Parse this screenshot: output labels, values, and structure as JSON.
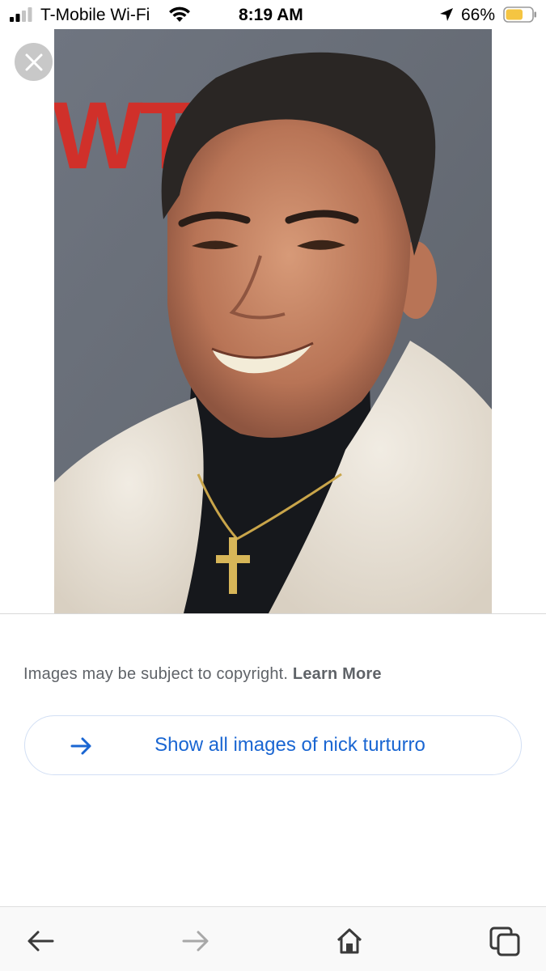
{
  "status_bar": {
    "carrier": "T-Mobile Wi-Fi",
    "time": "8:19 AM",
    "battery_percent": "66%",
    "battery_level": 0.66,
    "battery_color": "#f5c542",
    "icons": [
      "signal-icon",
      "wifi-icon",
      "location-icon",
      "battery-icon"
    ]
  },
  "viewer": {
    "close_icon": "close-icon",
    "photo": {
      "background_color": "#6e737b",
      "banner_text": "WTI",
      "banner_color": "#d0302a"
    }
  },
  "copyright": {
    "text": "Images may be subject to copyright.",
    "learn_more": "Learn More"
  },
  "show_all": {
    "label": "Show all images of nick turturro",
    "icon": "arrow-right-icon",
    "accent": "#1a66d2"
  },
  "toolbar": {
    "items": [
      "back-icon",
      "forward-icon",
      "home-icon",
      "tabs-icon"
    ]
  }
}
